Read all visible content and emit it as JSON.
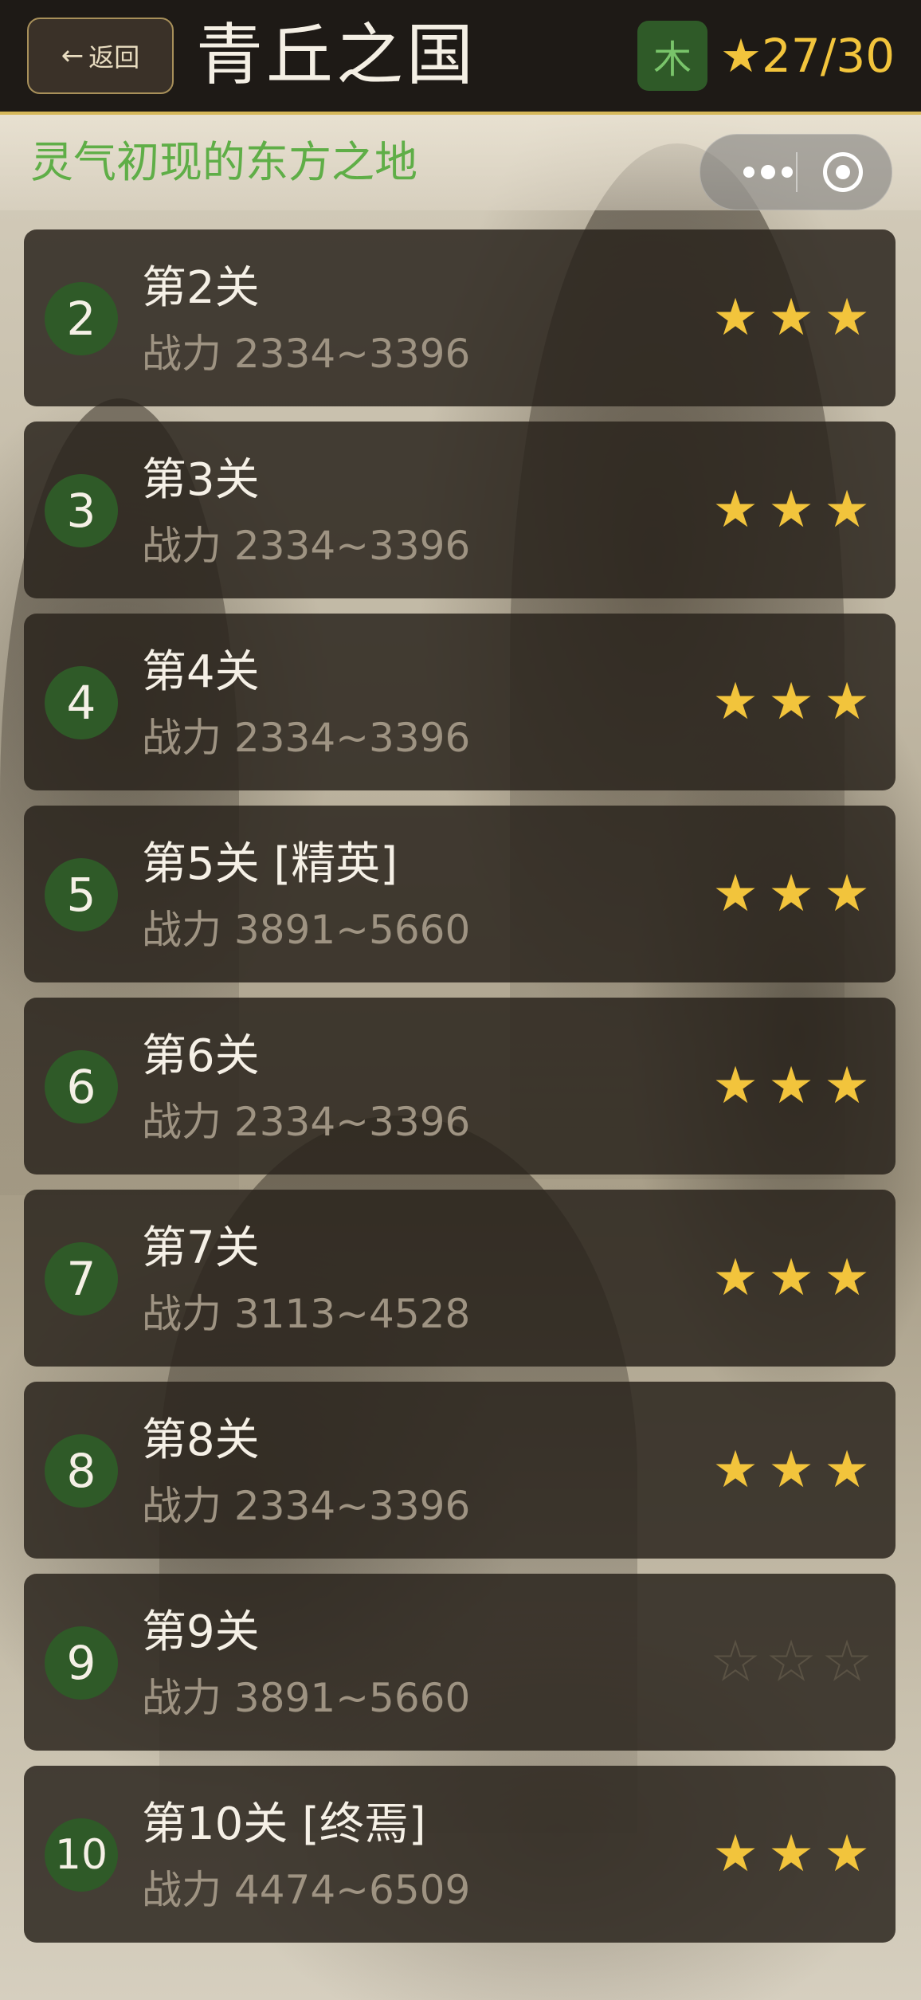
{
  "header": {
    "back_label": "返回",
    "title": "青丘之国",
    "element": "木",
    "star_total": "★27/30"
  },
  "subtitle": "灵气初现的东方之地",
  "colors": {
    "accent": "#f2c43c",
    "element_green": "#2f5a28",
    "subtitle_green": "#5fae47"
  },
  "levels": [
    {
      "num": "2",
      "name": "第2关",
      "power": "战力 2334~3396",
      "stars": 3
    },
    {
      "num": "3",
      "name": "第3关",
      "power": "战力 2334~3396",
      "stars": 3
    },
    {
      "num": "4",
      "name": "第4关",
      "power": "战力 2334~3396",
      "stars": 3
    },
    {
      "num": "5",
      "name": "第5关 [精英]",
      "power": "战力 3891~5660",
      "stars": 3
    },
    {
      "num": "6",
      "name": "第6关",
      "power": "战力 2334~3396",
      "stars": 3
    },
    {
      "num": "7",
      "name": "第7关",
      "power": "战力 3113~4528",
      "stars": 3
    },
    {
      "num": "8",
      "name": "第8关",
      "power": "战力 2334~3396",
      "stars": 3
    },
    {
      "num": "9",
      "name": "第9关",
      "power": "战力 3891~5660",
      "stars": 0
    },
    {
      "num": "10",
      "name": "第10关 [终焉]",
      "power": "战力 4474~6509",
      "stars": 3
    }
  ]
}
